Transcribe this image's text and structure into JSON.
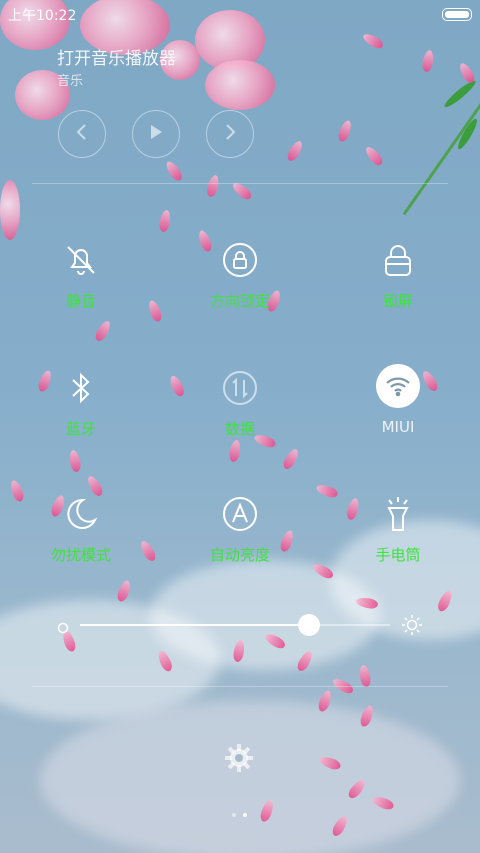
{
  "status_bar": {
    "time": "上午10:22",
    "battery_level": 1.0
  },
  "music": {
    "title": "打开音乐播放器",
    "subtitle": "音乐",
    "controls": [
      "previous-icon",
      "play-icon",
      "next-icon"
    ]
  },
  "toggles": [
    {
      "icon": "mute-bell-icon",
      "label": "静音"
    },
    {
      "icon": "rotation-lock-icon",
      "label": "方向锁定"
    },
    {
      "icon": "lock-screen-icon",
      "label": "锁屏"
    },
    {
      "icon": "bluetooth-icon",
      "label": "蓝牙"
    },
    {
      "icon": "mobile-data-icon",
      "label": "数据"
    },
    {
      "icon": "wifi-icon",
      "label": "MIUI"
    },
    {
      "icon": "do-not-disturb-moon-icon",
      "label": "勿扰模式"
    },
    {
      "icon": "auto-brightness-icon",
      "label": "自动亮度"
    },
    {
      "icon": "flashlight-icon",
      "label": "手电筒"
    }
  ],
  "brightness": {
    "level": 0.74
  },
  "settings_icon": "gear-icon",
  "pagination": {
    "pages": 2,
    "current": 2
  },
  "colors": {
    "active_label": "#3fe23f",
    "wifi_active_bg": "#ffffff"
  }
}
